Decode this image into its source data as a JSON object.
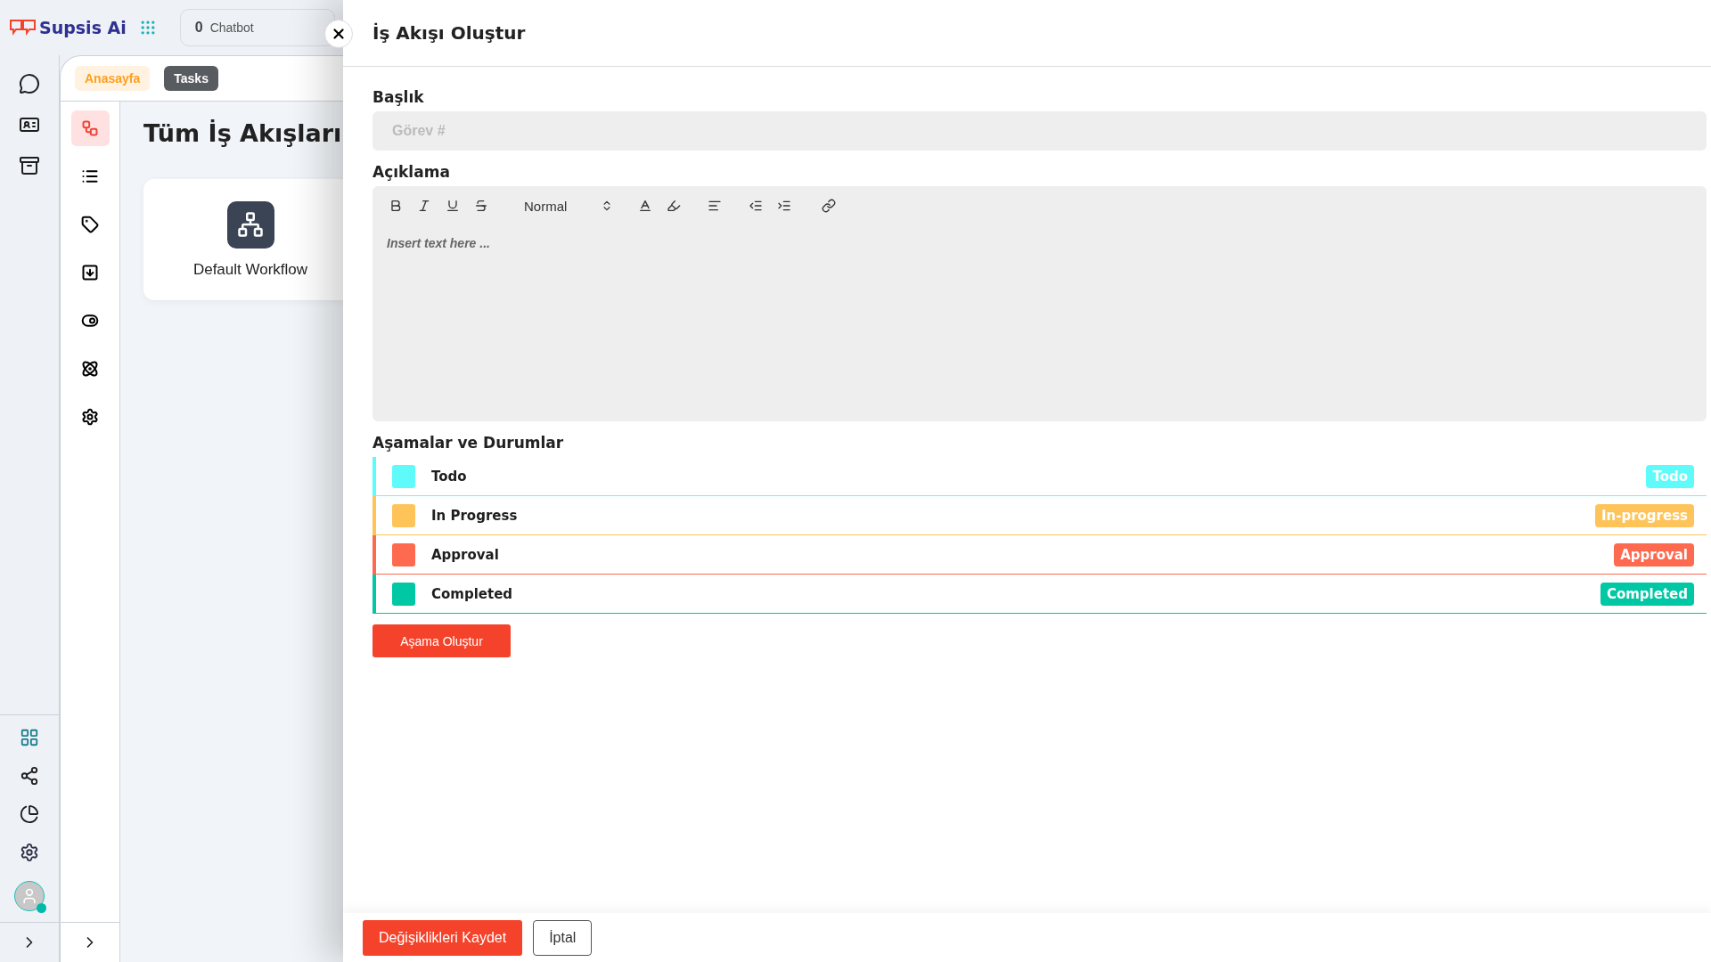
{
  "brand": {
    "name": "Supsis Ai"
  },
  "chatbot": {
    "count": "0",
    "label": "Chatbot"
  },
  "tabs": [
    {
      "label": "Anasayfa",
      "selected": false
    },
    {
      "label": "Tasks",
      "selected": true
    }
  ],
  "sidebar": {
    "items": [
      {
        "selected": true
      },
      {
        "selected": false
      },
      {
        "selected": false
      },
      {
        "selected": false
      },
      {
        "selected": false
      },
      {
        "selected": false
      },
      {
        "selected": false
      }
    ]
  },
  "page": {
    "title": "Tüm İş Akışları",
    "cards": [
      {
        "title": "Default Workflow"
      }
    ]
  },
  "drawer": {
    "title": "İş Akışı Oluştur",
    "title_field": {
      "label": "Başlık",
      "placeholder": "Görev #"
    },
    "description": {
      "label": "Açıklama",
      "heading_select": "Normal",
      "placeholder": "Insert text here ..."
    },
    "stages_heading": "Aşamalar ve Durumlar",
    "stages": [
      {
        "name": "Todo",
        "badge": "Todo",
        "color": "#5ffbfb"
      },
      {
        "name": "In Progress",
        "badge": "In-progress",
        "color": "#fec45a"
      },
      {
        "name": "Approval",
        "badge": "Approval",
        "color": "#fe6a4f"
      },
      {
        "name": "Completed",
        "badge": "Completed",
        "color": "#00c8a5"
      }
    ],
    "add_stage_button": "Aşama Oluştur",
    "footer": {
      "save": "Değişiklikleri Kaydet",
      "cancel": "İptal"
    }
  }
}
